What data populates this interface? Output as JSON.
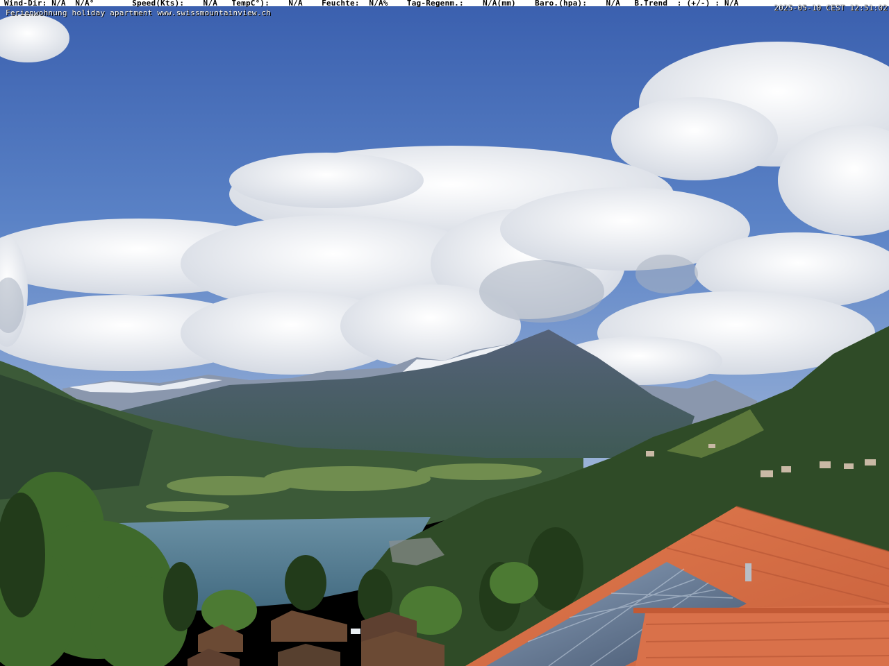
{
  "overlay": {
    "weather_line": "Wind-Dir: N/A  N/A°        Speed(Kts):    N/A   TempC°):    N/A    Feuchte:  N/A%    Tag-Regenm.:    N/A(mm)    Baro.(hpa):    N/A   B.Trend  : (+/-) : N/A",
    "caption": "Ferienwohnung holiday apartment www.swissmountainview.ch",
    "timestamp": "2025-05-10 CEST 12:51:02"
  },
  "colors": {
    "sky_top": "#3a63b3",
    "sky_mid": "#5b83c8",
    "cloud": "#f2f4f7",
    "mountain": "#4a5a73",
    "lake": "#4f7a8e",
    "forest": "#2f4a26",
    "roof": "#d9714a",
    "solar": "#5a6e88"
  }
}
